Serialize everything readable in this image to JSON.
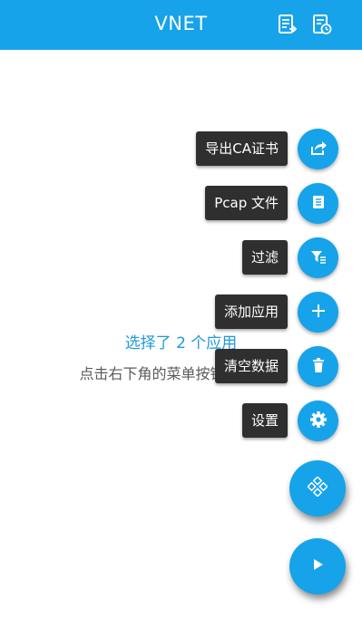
{
  "appbar": {
    "title": "VNET",
    "icons": [
      "log-export-icon",
      "history-icon"
    ],
    "background": "#16a3ea"
  },
  "main": {
    "selected_text": "选择了 2 个应用",
    "hint_text": "点击右下角的菜单按钮开始抓包"
  },
  "fab_menu": {
    "items": [
      {
        "label": "导出CA证书",
        "icon": "share-icon"
      },
      {
        "label": "Pcap 文件",
        "icon": "document-icon"
      },
      {
        "label": "过滤",
        "icon": "filter-icon"
      },
      {
        "label": "添加应用",
        "icon": "plus-icon"
      },
      {
        "label": "清空数据",
        "icon": "trash-icon"
      },
      {
        "label": "设置",
        "icon": "gear-icon"
      }
    ],
    "menu_icon": "diamond-grid-icon",
    "start_icon": "play-icon"
  }
}
